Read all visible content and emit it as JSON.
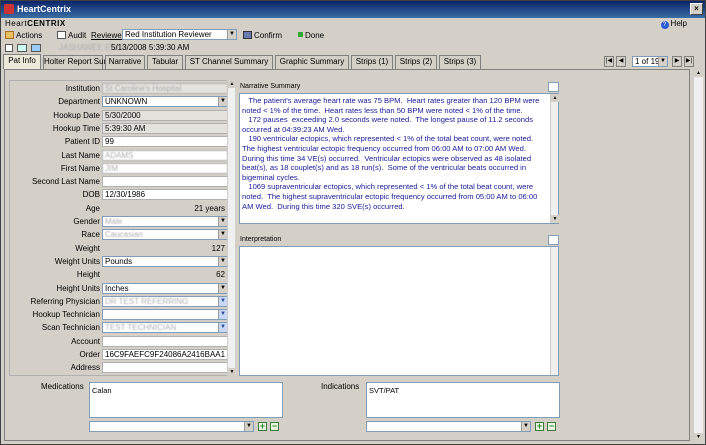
{
  "window": {
    "title": "HeartCentrix",
    "close_glyph": "×"
  },
  "brand": {
    "prefix": "Heart",
    "suffix": "CENTRIX"
  },
  "help_label": "Help",
  "toolbar": {
    "actions": "Actions",
    "audit": "Audit",
    "reviewer_label": "Reviewer",
    "reviewer_value": "Red Institution Reviewer",
    "confirm": "Confirm",
    "done": "Done"
  },
  "patient_bar": {
    "patient_name": "JASHAWEE EDER",
    "datetime": "5/13/2008 5:39:30 AM"
  },
  "tabs": [
    "Pat Info",
    "Holter Report Summary",
    "Narrative",
    "Tabular",
    "ST Channel Summary",
    "Graphic Summary",
    "Strips (1)",
    "Strips (2)",
    "Strips (3)"
  ],
  "pager": {
    "value": "1 of 19"
  },
  "fields": [
    {
      "label": "Institution",
      "value": "St Caroline's Hospital",
      "kind": "gray",
      "blur": true
    },
    {
      "label": "Department",
      "value": "UNKNOWN",
      "kind": "combo"
    },
    {
      "label": "Hookup Date",
      "value": "5/30/2000",
      "kind": "gray"
    },
    {
      "label": "Hookup Time",
      "value": "5:39:30 AM",
      "kind": "gray"
    },
    {
      "label": "Patient ID",
      "value": "99",
      "kind": "white"
    },
    {
      "label": "Last Name",
      "value": "ADAMS",
      "kind": "white",
      "blur": true
    },
    {
      "label": "First Name",
      "value": "JIM",
      "kind": "white",
      "blur": true
    },
    {
      "label": "Second Last Name",
      "value": "",
      "kind": "white"
    },
    {
      "label": "DOB",
      "value": "12/30/1986",
      "kind": "white"
    },
    {
      "label": "Age",
      "value": "21 years",
      "kind": "num"
    },
    {
      "label": "Gender",
      "value": "Male",
      "kind": "combo",
      "blur": true
    },
    {
      "label": "Race",
      "value": "Caucasian",
      "kind": "combo",
      "blur": true
    },
    {
      "label": "Weight",
      "value": "127",
      "kind": "numbox"
    },
    {
      "label": "Weight Units",
      "value": "Pounds",
      "kind": "combo"
    },
    {
      "label": "Height",
      "value": "62",
      "kind": "numbox"
    },
    {
      "label": "Height Units",
      "value": "Inches",
      "kind": "combo"
    },
    {
      "label": "Referring Physician",
      "value": "DR TEST REFERRING",
      "kind": "bluecombo",
      "blur": true
    },
    {
      "label": "Hookup Technician",
      "value": "",
      "kind": "bluecombo"
    },
    {
      "label": "Scan Technician",
      "value": "TEST TECHNICIAN",
      "kind": "bluecombo",
      "blur": true
    },
    {
      "label": "Account",
      "value": "",
      "kind": "white"
    },
    {
      "label": "Order",
      "value": "16C9FAEFC9F24086A2416BAA1",
      "kind": "white"
    },
    {
      "label": "Address",
      "value": "",
      "kind": "white"
    }
  ],
  "narrative": {
    "header": "Narrative Summary",
    "text": "   The patient's average heart rate was 75 BPM.  Heart rates greater than 120 BPM were noted < 1% of the time.  Heart rates less than 50 BPM were noted < 1% of the time.\n   172 pauses  exceeding 2.0 seconds were noted.  The longest pause of 11.2 seconds occurred at 04:39:23 AM Wed.\n   190 ventricular ectopics, which represented < 1% of the total beat count, were noted.  The highest ventricular ectopic frequency occurred from 06:00 AM to 07:00 AM Wed.  During this time 34 VE(s) occurred.  Ventricular ectopics were observed as 48 isolated beat(s), as 18 couplet(s) and as 18 run(s).  Some of the ventricular beats occurred in bigeminal cycles.\n   1069 supraventricular ectopics, which represented < 1% of the total beat count, were noted.  The highest supraventricular ectopic frequency occurred from 05:00 AM to 06:00 AM Wed.  During this time 320 SVE(s) occurred."
  },
  "interpretation": {
    "header": "Interpretation",
    "text": ""
  },
  "medications": {
    "label": "Medications",
    "items": [
      "Calan"
    ]
  },
  "indications": {
    "label": "Indications",
    "items": [
      "SVT/PAT"
    ]
  },
  "buttons": {
    "plus": "+",
    "minus": "−"
  },
  "colors": {
    "narrative_text": "#1a1a9a",
    "title_bar": "#0a246a"
  }
}
